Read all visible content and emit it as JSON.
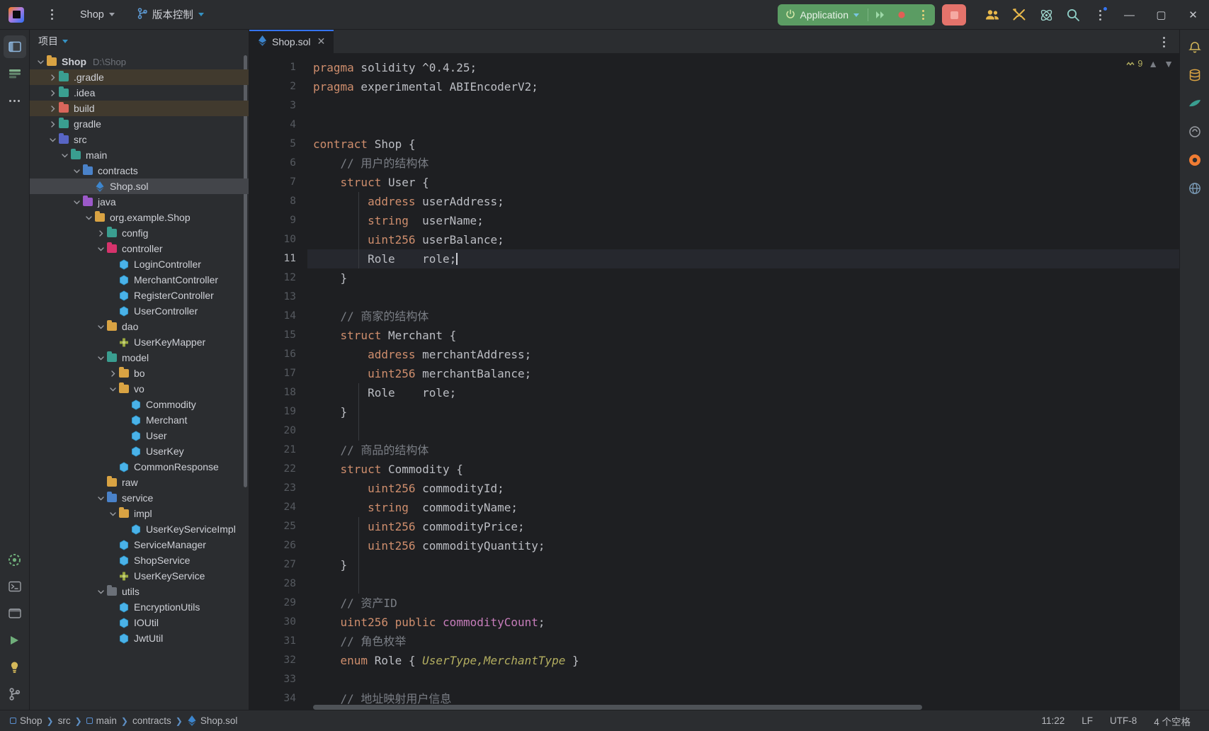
{
  "titlebar": {
    "logo": "intellij-logo",
    "main_menu": "main-menu-icon",
    "project_name": "Shop",
    "vcs_label": "版本控制",
    "run_config": "Application",
    "icons": [
      "people-icon",
      "tools-icon",
      "atom-icon",
      "search-icon",
      "more-icon"
    ],
    "window": {
      "minimize": "—",
      "maximize": "▢",
      "close": "✕"
    }
  },
  "project_panel": {
    "title": "项目",
    "tree": [
      {
        "label": "Shop",
        "path": "D:\\Shop",
        "depth": 0,
        "arrow": "down",
        "icon": "folder-yellow",
        "bold": true
      },
      {
        "label": ".gradle",
        "depth": 1,
        "arrow": "right",
        "icon": "folder-teal-gradle",
        "ignored": true
      },
      {
        "label": ".idea",
        "depth": 1,
        "arrow": "right",
        "icon": "folder-idea"
      },
      {
        "label": "build",
        "depth": 1,
        "arrow": "right",
        "icon": "folder-red",
        "ignored": true
      },
      {
        "label": "gradle",
        "depth": 1,
        "arrow": "right",
        "icon": "folder-teal-gradle"
      },
      {
        "label": "src",
        "depth": 1,
        "arrow": "down",
        "icon": "folder-src"
      },
      {
        "label": "main",
        "depth": 2,
        "arrow": "down",
        "icon": "folder-teal-module"
      },
      {
        "label": "contracts",
        "depth": 3,
        "arrow": "down",
        "icon": "folder-blue-resources"
      },
      {
        "label": "Shop.sol",
        "depth": 4,
        "arrow": "none",
        "icon": "solidity-file",
        "selected": true
      },
      {
        "label": "java",
        "depth": 3,
        "arrow": "down",
        "icon": "folder-purple-java"
      },
      {
        "label": "org.example.Shop",
        "depth": 4,
        "arrow": "down",
        "icon": "folder-package"
      },
      {
        "label": "config",
        "depth": 5,
        "arrow": "right",
        "icon": "folder-teal-config"
      },
      {
        "label": "controller",
        "depth": 5,
        "arrow": "down",
        "icon": "folder-pink-controller"
      },
      {
        "label": "LoginController",
        "depth": 6,
        "arrow": "none",
        "icon": "class-icon"
      },
      {
        "label": "MerchantController",
        "depth": 6,
        "arrow": "none",
        "icon": "class-icon"
      },
      {
        "label": "RegisterController",
        "depth": 6,
        "arrow": "none",
        "icon": "class-icon"
      },
      {
        "label": "UserController",
        "depth": 6,
        "arrow": "none",
        "icon": "class-icon"
      },
      {
        "label": "dao",
        "depth": 5,
        "arrow": "down",
        "icon": "folder-yellow"
      },
      {
        "label": "UserKeyMapper",
        "depth": 6,
        "arrow": "none",
        "icon": "interface-icon"
      },
      {
        "label": "model",
        "depth": 5,
        "arrow": "down",
        "icon": "folder-teal-model"
      },
      {
        "label": "bo",
        "depth": 6,
        "arrow": "right",
        "icon": "folder-yellow"
      },
      {
        "label": "vo",
        "depth": 6,
        "arrow": "down",
        "icon": "folder-yellow"
      },
      {
        "label": "Commodity",
        "depth": 7,
        "arrow": "none",
        "icon": "class-icon"
      },
      {
        "label": "Merchant",
        "depth": 7,
        "arrow": "none",
        "icon": "class-icon"
      },
      {
        "label": "User",
        "depth": 7,
        "arrow": "none",
        "icon": "class-icon"
      },
      {
        "label": "UserKey",
        "depth": 7,
        "arrow": "none",
        "icon": "class-icon"
      },
      {
        "label": "CommonResponse",
        "depth": 6,
        "arrow": "none",
        "icon": "class-icon"
      },
      {
        "label": "raw",
        "depth": 5,
        "arrow": "none",
        "icon": "folder-yellow"
      },
      {
        "label": "service",
        "depth": 5,
        "arrow": "down",
        "icon": "folder-blue-service"
      },
      {
        "label": "impl",
        "depth": 6,
        "arrow": "down",
        "icon": "folder-yellow"
      },
      {
        "label": "UserKeyServiceImpl",
        "depth": 7,
        "arrow": "none",
        "icon": "class-icon"
      },
      {
        "label": "ServiceManager",
        "depth": 6,
        "arrow": "none",
        "icon": "class-icon"
      },
      {
        "label": "ShopService",
        "depth": 6,
        "arrow": "none",
        "icon": "class-icon"
      },
      {
        "label": "UserKeyService",
        "depth": 6,
        "arrow": "none",
        "icon": "interface-icon"
      },
      {
        "label": "utils",
        "depth": 5,
        "arrow": "down",
        "icon": "folder-gray-utils"
      },
      {
        "label": "EncryptionUtils",
        "depth": 6,
        "arrow": "none",
        "icon": "class-icon"
      },
      {
        "label": "IOUtil",
        "depth": 6,
        "arrow": "none",
        "icon": "class-icon"
      },
      {
        "label": "JwtUtil",
        "depth": 6,
        "arrow": "none",
        "icon": "class-icon"
      }
    ]
  },
  "editor": {
    "tab": {
      "label": "Shop.sol",
      "icon": "solidity-file",
      "close": "✕"
    },
    "inspection": {
      "count": "9",
      "up": "▲",
      "down": "▼"
    },
    "current_line": 11,
    "lines": [
      {
        "n": 1,
        "tokens": [
          {
            "t": "pragma",
            "c": "k"
          },
          {
            "t": " solidity ^0.4.25;",
            "c": "t"
          }
        ]
      },
      {
        "n": 2,
        "tokens": [
          {
            "t": "pragma",
            "c": "k"
          },
          {
            "t": " experimental ABIEncoderV2;",
            "c": "t"
          }
        ]
      },
      {
        "n": 3,
        "tokens": []
      },
      {
        "n": 4,
        "tokens": []
      },
      {
        "n": 5,
        "tokens": [
          {
            "t": "contract",
            "c": "k"
          },
          {
            "t": " Shop {",
            "c": "t"
          }
        ]
      },
      {
        "n": 6,
        "tokens": [
          {
            "t": "    // 用户的结构体",
            "c": "c"
          }
        ]
      },
      {
        "n": 7,
        "tokens": [
          {
            "t": "    ",
            "c": "t"
          },
          {
            "t": "struct",
            "c": "k"
          },
          {
            "t": " User {",
            "c": "t"
          }
        ]
      },
      {
        "n": 8,
        "tokens": [
          {
            "t": "        ",
            "c": "t"
          },
          {
            "t": "address",
            "c": "k"
          },
          {
            "t": " userAddress;",
            "c": "t"
          }
        ]
      },
      {
        "n": 9,
        "tokens": [
          {
            "t": "        ",
            "c": "t"
          },
          {
            "t": "string",
            "c": "k"
          },
          {
            "t": "  userName;",
            "c": "t"
          }
        ]
      },
      {
        "n": 10,
        "tokens": [
          {
            "t": "        ",
            "c": "t"
          },
          {
            "t": "uint256",
            "c": "k"
          },
          {
            "t": " userBalance;",
            "c": "t"
          }
        ]
      },
      {
        "n": 11,
        "tokens": [
          {
            "t": "        Role    role;",
            "c": "t"
          }
        ],
        "cursor": true
      },
      {
        "n": 12,
        "tokens": [
          {
            "t": "    }",
            "c": "t"
          }
        ]
      },
      {
        "n": 13,
        "tokens": []
      },
      {
        "n": 14,
        "tokens": [
          {
            "t": "    // 商家的结构体",
            "c": "c"
          }
        ]
      },
      {
        "n": 15,
        "tokens": [
          {
            "t": "    ",
            "c": "t"
          },
          {
            "t": "struct",
            "c": "k"
          },
          {
            "t": " Merchant {",
            "c": "t"
          }
        ]
      },
      {
        "n": 16,
        "tokens": [
          {
            "t": "        ",
            "c": "t"
          },
          {
            "t": "address",
            "c": "k"
          },
          {
            "t": " merchantAddress;",
            "c": "t"
          }
        ]
      },
      {
        "n": 17,
        "tokens": [
          {
            "t": "        ",
            "c": "t"
          },
          {
            "t": "uint256",
            "c": "k"
          },
          {
            "t": " merchantBalance;",
            "c": "t"
          }
        ]
      },
      {
        "n": 18,
        "tokens": [
          {
            "t": "        Role    role;",
            "c": "t"
          }
        ]
      },
      {
        "n": 19,
        "tokens": [
          {
            "t": "    }",
            "c": "t"
          }
        ]
      },
      {
        "n": 20,
        "tokens": []
      },
      {
        "n": 21,
        "tokens": [
          {
            "t": "    // 商品的结构体",
            "c": "c"
          }
        ]
      },
      {
        "n": 22,
        "tokens": [
          {
            "t": "    ",
            "c": "t"
          },
          {
            "t": "struct",
            "c": "k"
          },
          {
            "t": " Commodity {",
            "c": "t"
          }
        ]
      },
      {
        "n": 23,
        "tokens": [
          {
            "t": "        ",
            "c": "t"
          },
          {
            "t": "uint256",
            "c": "k"
          },
          {
            "t": " commodityId;",
            "c": "t"
          }
        ]
      },
      {
        "n": 24,
        "tokens": [
          {
            "t": "        ",
            "c": "t"
          },
          {
            "t": "string",
            "c": "k"
          },
          {
            "t": "  commodityName;",
            "c": "t"
          }
        ]
      },
      {
        "n": 25,
        "tokens": [
          {
            "t": "        ",
            "c": "t"
          },
          {
            "t": "uint256",
            "c": "k"
          },
          {
            "t": " commodityPrice;",
            "c": "t"
          }
        ]
      },
      {
        "n": 26,
        "tokens": [
          {
            "t": "        ",
            "c": "t"
          },
          {
            "t": "uint256",
            "c": "k"
          },
          {
            "t": " commodityQuantity;",
            "c": "t"
          }
        ]
      },
      {
        "n": 27,
        "tokens": [
          {
            "t": "    }",
            "c": "t"
          }
        ]
      },
      {
        "n": 28,
        "tokens": []
      },
      {
        "n": 29,
        "tokens": [
          {
            "t": "    // 资产ID",
            "c": "c"
          }
        ]
      },
      {
        "n": 30,
        "tokens": [
          {
            "t": "    ",
            "c": "t"
          },
          {
            "t": "uint256",
            "c": "k"
          },
          {
            "t": " ",
            "c": "t"
          },
          {
            "t": "public",
            "c": "k"
          },
          {
            "t": " ",
            "c": "t"
          },
          {
            "t": "commodityCount",
            "c": "f"
          },
          {
            "t": ";",
            "c": "t"
          }
        ]
      },
      {
        "n": 31,
        "tokens": [
          {
            "t": "    // 角色枚举",
            "c": "c"
          }
        ]
      },
      {
        "n": 32,
        "tokens": [
          {
            "t": "    ",
            "c": "t"
          },
          {
            "t": "enum",
            "c": "k"
          },
          {
            "t": " Role { ",
            "c": "t"
          },
          {
            "t": "UserType,MerchantType",
            "c": "e"
          },
          {
            "t": " }",
            "c": "t"
          }
        ]
      },
      {
        "n": 33,
        "tokens": []
      },
      {
        "n": 34,
        "tokens": [
          {
            "t": "    // 地址映射用户信息",
            "c": "c"
          }
        ]
      }
    ]
  },
  "statusbar": {
    "breadcrumb": [
      {
        "label": "Shop",
        "icon": "module-icon"
      },
      {
        "label": "src",
        "icon": "none"
      },
      {
        "label": "main",
        "icon": "module-icon"
      },
      {
        "label": "contracts",
        "icon": "none"
      },
      {
        "label": "Shop.sol",
        "icon": "solidity-file"
      }
    ],
    "caret": "11:22",
    "line_separator": "LF",
    "encoding": "UTF-8",
    "indent": "4 个空格"
  }
}
